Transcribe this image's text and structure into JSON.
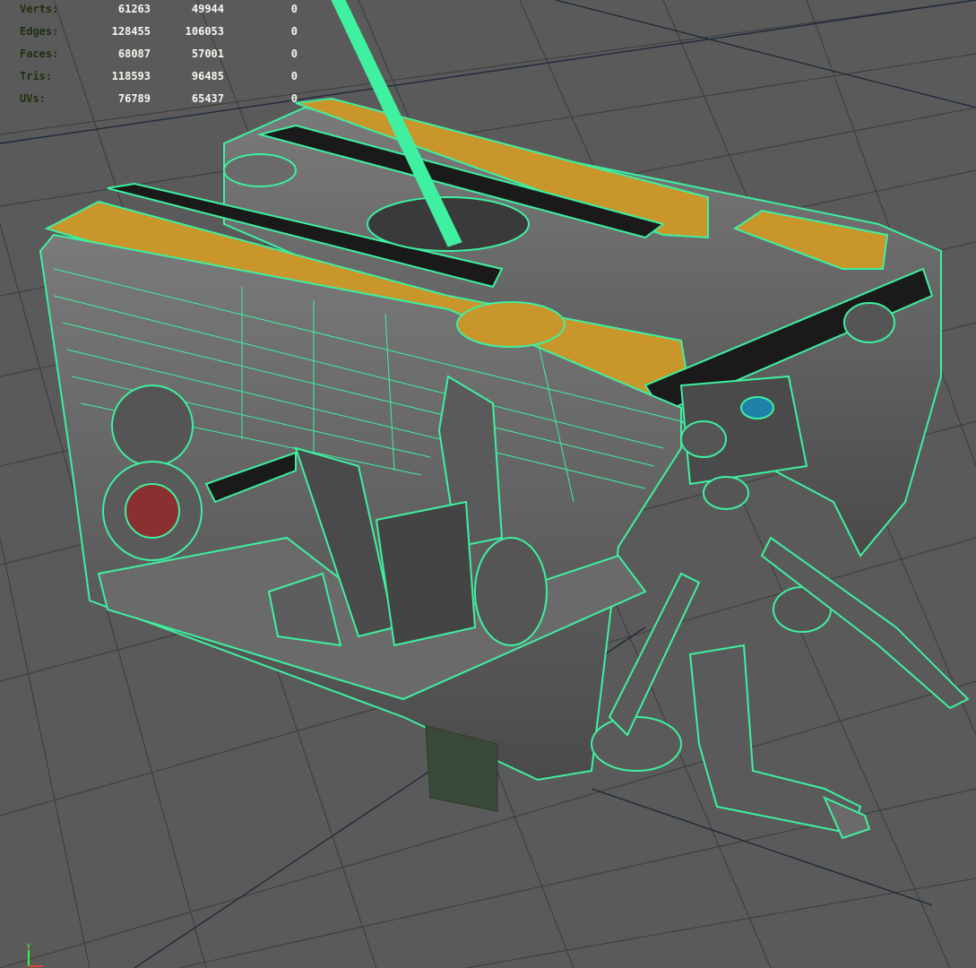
{
  "viewport": {
    "background_color": "#5a5a5a",
    "grid_color": "#3a3a3a",
    "wire_color": "#3ef0a0",
    "highlight_color": "#c8962a",
    "dark_color": "#1a1a1a"
  },
  "poly_count": {
    "rows": [
      {
        "label": "Verts:",
        "values": [
          "61263",
          "49944",
          "0"
        ]
      },
      {
        "label": "Edges:",
        "values": [
          "128455",
          "106053",
          "0"
        ]
      },
      {
        "label": "Faces:",
        "values": [
          "68087",
          "57001",
          "0"
        ]
      },
      {
        "label": "Tris:",
        "values": [
          "118593",
          "96485",
          "0"
        ]
      },
      {
        "label": "UVs:",
        "values": [
          "76789",
          "65437",
          "0"
        ]
      }
    ]
  },
  "axis_indicator": {
    "y_label": "Y",
    "x_label": "X"
  }
}
